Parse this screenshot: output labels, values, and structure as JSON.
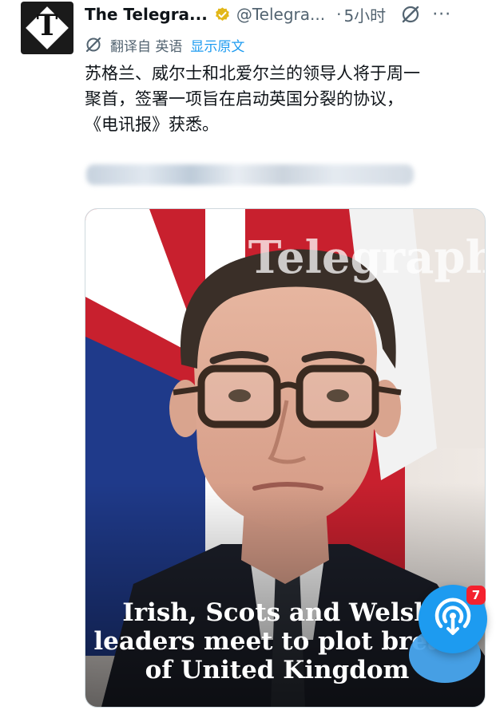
{
  "tweet": {
    "author_name": "The Telegra...",
    "author_handle": "@Telegra...",
    "separator": "·",
    "time": "5小时",
    "more_icon": "more-icon",
    "avatar_letter": "T",
    "verified": true,
    "translation": {
      "label": "翻译自 英语",
      "show_original": "显示原文"
    },
    "text_lines": [
      "苏格兰、威尔士和北爱尔兰的领导人将于周一",
      "聚首，签署一项旨在启动英国分裂的协议，",
      "《电讯报》获悉。"
    ],
    "media": {
      "watermark": "Telegraph",
      "headline_lines": [
        "Irish, Scots and Welsh",
        "leaders meet to plot break",
        "of United Kingdom"
      ]
    }
  },
  "floating_button": {
    "icon": "podcast-icon",
    "badge_count": "7"
  },
  "colors": {
    "accent": "#1d9bf0",
    "verified_gold": "#e2b719",
    "badge_red": "#f4212e",
    "secondary_text": "#536471"
  }
}
